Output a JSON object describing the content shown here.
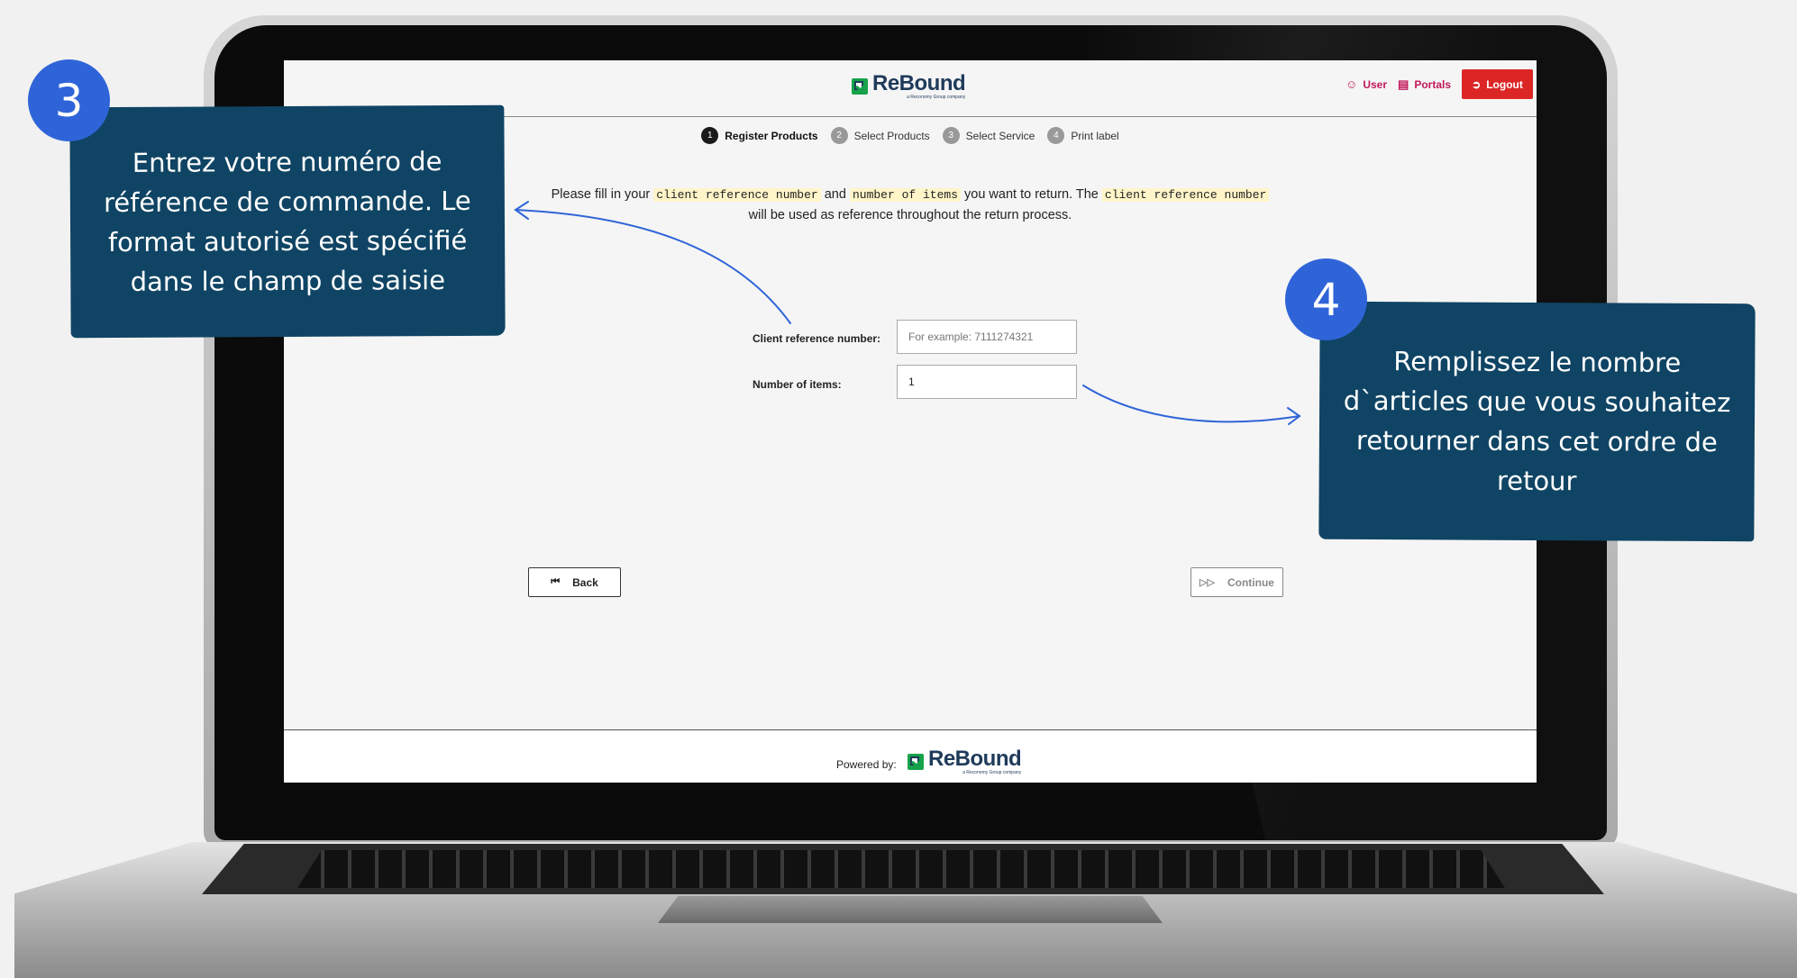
{
  "header": {
    "brand": "ReBound",
    "brand_tagline": "a Reconomy Group company",
    "nav": {
      "user": "User",
      "portals": "Portals",
      "logout": "Logout"
    }
  },
  "steps": [
    {
      "num": "1",
      "label": "Register Products",
      "active": true
    },
    {
      "num": "2",
      "label": "Select Products",
      "active": false
    },
    {
      "num": "3",
      "label": "Select Service",
      "active": false
    },
    {
      "num": "4",
      "label": "Print label",
      "active": false
    }
  ],
  "intro": {
    "p1": "Please fill in your ",
    "code1": "client reference number",
    "p2": " and ",
    "code2": "number of items",
    "p3": " you want to return. The ",
    "code3": "client reference number",
    "p4": " will be used as reference throughout the return process."
  },
  "form": {
    "client_ref_label": "Client reference number:",
    "client_ref_placeholder": "For example: 7111274321",
    "client_ref_value": "",
    "items_label": "Number of items:",
    "items_value": "1"
  },
  "buttons": {
    "back": "Back",
    "continue": "Continue"
  },
  "footer": {
    "powered_by": "Powered by:",
    "brand": "ReBound",
    "brand_tagline": "a Reconomy Group company"
  },
  "callouts": {
    "step3": {
      "number": "3",
      "text": "Entrez votre numéro de référence de commande. Le format autorisé est spécifié dans le champ de saisie"
    },
    "step4": {
      "number": "4",
      "text": "Remplissez le nombre d`articles que vous souhaitez retourner dans cet ordre de retour"
    }
  },
  "colors": {
    "accent_blue": "#2f64d8",
    "callout_bg": "#0f4464",
    "logout_red": "#dc2626",
    "nav_pink": "#c2185b",
    "brand_green": "#16a34a",
    "brand_navy": "#1f3a5a"
  },
  "icons": {
    "user": "user-icon",
    "portals": "portals-icon",
    "logout": "logout-icon",
    "back": "skip-back-icon",
    "continue": "fast-forward-icon"
  }
}
